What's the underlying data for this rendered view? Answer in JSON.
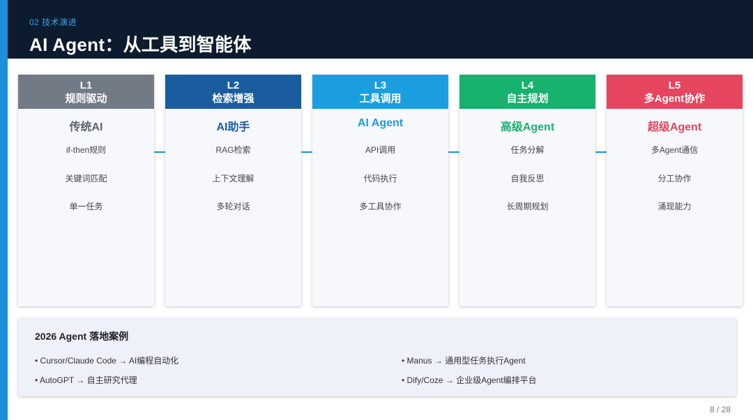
{
  "header": {
    "section": "02  技术演进",
    "title": "AI Agent：从工具到智能体"
  },
  "levels": [
    {
      "level": "L1",
      "category": "规则驱动",
      "name": "传统AI",
      "features": [
        "if-then规则",
        "关键词匹配",
        "单一任务"
      ],
      "head_color": "#727a85",
      "name_color": "#5b636e"
    },
    {
      "level": "L2",
      "category": "检索增强",
      "name": "AI助手",
      "features": [
        "RAG检索",
        "上下文理解",
        "多轮对话"
      ],
      "head_color": "#1a5d9f",
      "name_color": "#1a5d9f"
    },
    {
      "level": "L3",
      "category": "工具调用",
      "name": "AI Agent",
      "features": [
        "API调用",
        "代码执行",
        "多工具协作"
      ],
      "head_color": "#1a9ee0",
      "name_color": "#1a9ee0"
    },
    {
      "level": "L4",
      "category": "自主规划",
      "name": "高级Agent",
      "features": [
        "任务分解",
        "自我反思",
        "长周期规划"
      ],
      "head_color": "#17b26e",
      "name_color": "#17b26e"
    },
    {
      "level": "L5",
      "category": "多Agent协作",
      "name": "超级Agent",
      "features": [
        "多Agent通信",
        "分工协作",
        "涌现能力"
      ],
      "head_color": "#e5455e",
      "name_color": "#e5455e"
    }
  ],
  "cases": {
    "title": "2026 Agent 落地案例",
    "items": [
      "• Cursor/Claude Code → AI编程自动化",
      "• Manus → 通用型任务执行Agent",
      "• AutoGPT → 自主研究代理",
      "• Dify/Coze → 企业级Agent编排平台"
    ]
  },
  "footer": {
    "page": "8 / 28"
  },
  "colors": {
    "accent": "#1b8fd9",
    "header_bg": "#0d1b2e"
  }
}
